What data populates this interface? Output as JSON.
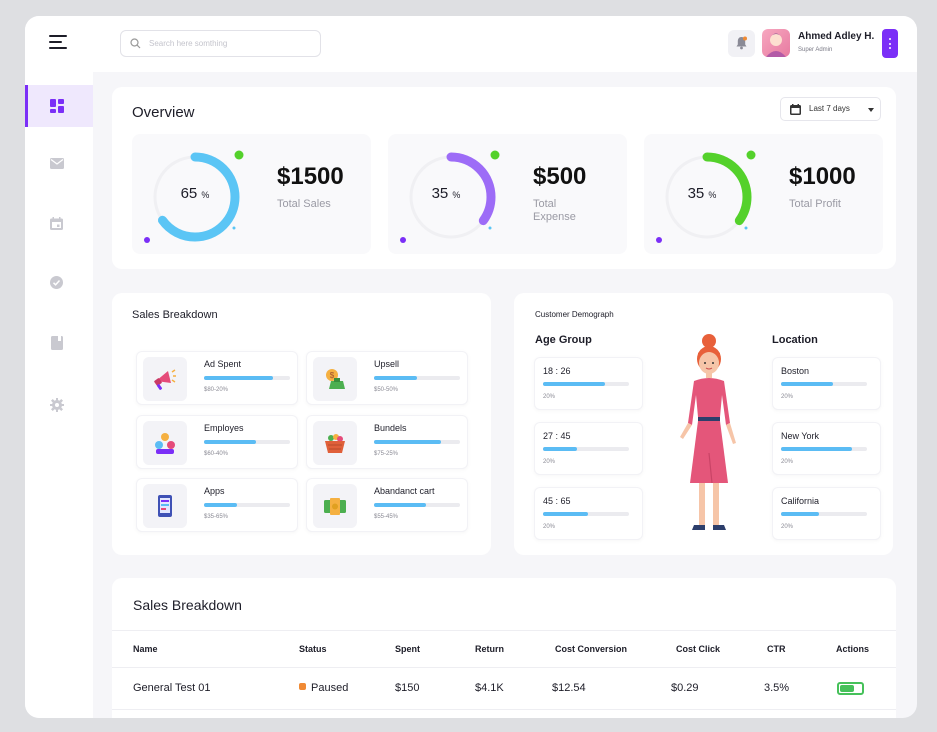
{
  "topbar": {
    "search_placeholder": "Search here somthing",
    "user_name": "Ahmed Adley H.",
    "user_role": "Super Admin"
  },
  "sidebar": {
    "items": [
      {
        "icon": "dashboard-icon",
        "active": true
      },
      {
        "icon": "mail-icon",
        "active": false
      },
      {
        "icon": "calendar-icon",
        "active": false
      },
      {
        "icon": "check-circle-icon",
        "active": false
      },
      {
        "icon": "document-icon",
        "active": false
      },
      {
        "icon": "gear-icon",
        "active": false
      }
    ]
  },
  "overview": {
    "title": "Overview",
    "period": "Last 7 days",
    "stats": [
      {
        "percent": "65",
        "unit": "%",
        "value": "$1500",
        "label": "Total Sales",
        "progress": 0.65,
        "color": "#5bc5f5",
        "dot": "#54d12b"
      },
      {
        "percent": "35",
        "unit": "%",
        "value": "$500",
        "label": "Total Expense",
        "progress": 0.35,
        "color": "#9d6cf7",
        "dot": "#54d12b"
      },
      {
        "percent": "35",
        "unit": "%",
        "value": "$1000",
        "label": "Total Profit",
        "progress": 0.35,
        "color": "#54d12b",
        "dot": "#54d12b"
      }
    ]
  },
  "sales_breakdown": {
    "title": "Sales Breakdown",
    "items": [
      {
        "name": "Ad Spent",
        "range": "$80-20%",
        "progress": 0.8,
        "icon": "megaphone-icon"
      },
      {
        "name": "Upsell",
        "range": "$50-50%",
        "progress": 0.5,
        "icon": "money-bag-icon"
      },
      {
        "name": "Employes",
        "range": "$60-40%",
        "progress": 0.6,
        "icon": "team-icon"
      },
      {
        "name": "Bundels",
        "range": "$75-25%",
        "progress": 0.78,
        "icon": "basket-icon"
      },
      {
        "name": "Apps",
        "range": "$35-65%",
        "progress": 0.38,
        "icon": "phone-app-icon"
      },
      {
        "name": "Abandanct cart",
        "range": "$55-45%",
        "progress": 0.6,
        "icon": "cash-icon"
      }
    ]
  },
  "demographics": {
    "title": "Customer Demograph",
    "age_heading": "Age Group",
    "location_heading": "Location",
    "age_groups": [
      {
        "range": "18 : 26",
        "percent": "20%",
        "progress": 0.72
      },
      {
        "range": "27 : 45",
        "percent": "20%",
        "progress": 0.4
      },
      {
        "range": "45 : 65",
        "percent": "20%",
        "progress": 0.52
      }
    ],
    "locations": [
      {
        "name": "Boston",
        "percent": "20%",
        "progress": 0.6
      },
      {
        "name": "New York",
        "percent": "20%",
        "progress": 0.82
      },
      {
        "name": "California",
        "percent": "20%",
        "progress": 0.44
      }
    ]
  },
  "table": {
    "title": "Sales Breakdown",
    "columns": [
      "Name",
      "Status",
      "Spent",
      "Return",
      "Cost Conversion",
      "Cost Click",
      "CTR",
      "Actions"
    ],
    "rows": [
      {
        "name": "General Test 01",
        "status": "Paused",
        "spent": "$150",
        "return": "$4.1K",
        "cost_conversion": "$12.54",
        "cost_click": "$0.29",
        "ctr": "3.5%",
        "active": true
      }
    ]
  },
  "colors": {
    "accent": "#7b2ff7",
    "bar": "#5bbcf4",
    "status_paused": "#f08a34",
    "toggle_on": "#46c15a"
  }
}
